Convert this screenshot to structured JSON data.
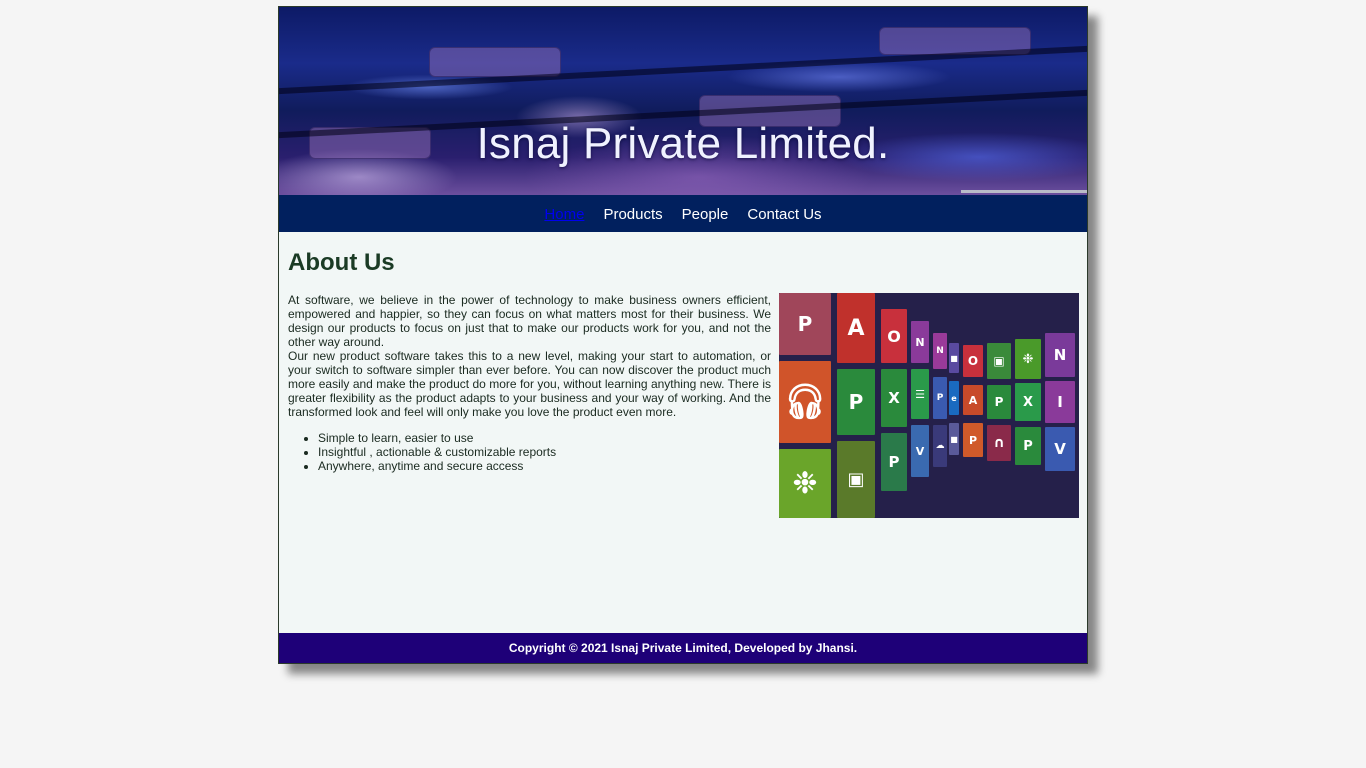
{
  "banner": {
    "title": "Isnaj Private Limited."
  },
  "nav": {
    "items": [
      {
        "label": "Home",
        "active": true
      },
      {
        "label": "Products",
        "active": false
      },
      {
        "label": "People",
        "active": false
      },
      {
        "label": "Contact Us",
        "active": false
      }
    ]
  },
  "main": {
    "heading": "About Us",
    "paragraph1": "At software, we believe in the power of technology to make business owners efficient, empowered and happier, so they can focus on what matters most for their business. We design our products to focus on just that to make our products work for you, and not the other way around.",
    "paragraph2": "Our new product software takes this to a new level, making your start to automation, or your switch to software simpler than ever before. You can now discover the product much more easily and make the product do more for you, without learning anything new. There is greater flexibility as the product adapts to your business and your way of working. And the transformed look and feel will only make you love the product even more.",
    "features": [
      "Simple to learn, easier to use",
      "Insightful , actionable & customizable reports",
      "Anywhere, anytime and secure access"
    ]
  },
  "footer": {
    "text": "Copyright © 2021 Isnaj Private Limited, Developed by Jhansi."
  },
  "colors": {
    "nav_bg": "#01205e",
    "footer_bg": "#1e0078",
    "page_bg": "#f2f7f6",
    "heading": "#1b3b25"
  }
}
